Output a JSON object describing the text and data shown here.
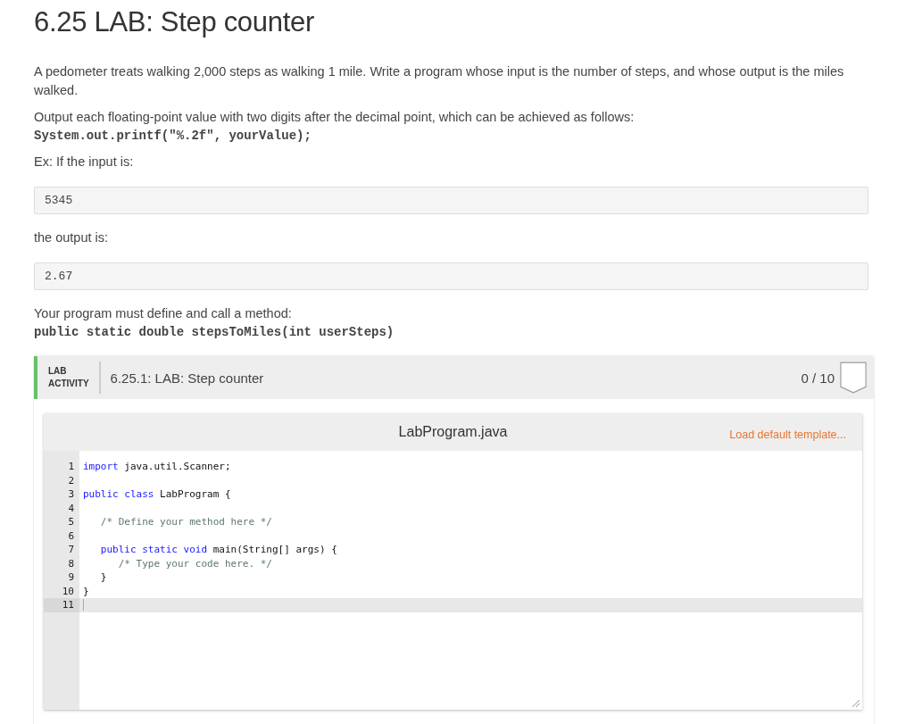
{
  "title": "6.25 LAB: Step counter",
  "paragraphs": [
    {
      "kind": "text",
      "text": "A pedometer treats walking 2,000 steps as walking 1 mile. Write a program whose input is the number of steps, and whose output is the miles walked."
    },
    {
      "kind": "text",
      "text": "Output each floating-point value with two digits after the decimal point, which can be achieved as follows:",
      "code": "System.out.printf(\"%.2f\", yourValue);"
    },
    {
      "kind": "text",
      "text": "Ex: If the input is:"
    },
    {
      "kind": "sample",
      "text": "5345"
    },
    {
      "kind": "text",
      "text": "the output is:"
    },
    {
      "kind": "sample",
      "text": "2.67"
    },
    {
      "kind": "text",
      "text": "Your program must define and call a method:",
      "code": "public static double stepsToMiles(int userSteps)"
    }
  ],
  "lab": {
    "label_lines": [
      "LAB",
      "ACTIVITY"
    ],
    "title": "6.25.1: LAB: Step counter",
    "score": "0 / 10",
    "completed": false,
    "editor": {
      "filename": "LabProgram.java",
      "template_link": "Load default template...",
      "lines": [
        {
          "number": "1",
          "active": false,
          "tokens": [
            {
              "kind": "keyword",
              "text": "import"
            },
            {
              "kind": "plain",
              "text": " java.util.Scanner;"
            }
          ]
        },
        {
          "number": "2",
          "active": false
        },
        {
          "number": "3",
          "active": false,
          "tokens": [
            {
              "kind": "keyword",
              "text": "public class"
            },
            {
              "kind": "plain",
              "text": " LabProgram {"
            }
          ]
        },
        {
          "number": "4",
          "active": false
        },
        {
          "number": "5",
          "active": false,
          "tokens": [
            {
              "kind": "comment",
              "text": "   /* Define your method here */"
            }
          ]
        },
        {
          "number": "6",
          "active": false
        },
        {
          "number": "7",
          "active": false,
          "tokens": [
            {
              "kind": "keyword",
              "text": "   public static void"
            },
            {
              "kind": "plain",
              "text": " main(String[] args) {"
            }
          ]
        },
        {
          "number": "8",
          "active": false,
          "tokens": [
            {
              "kind": "comment",
              "text": "      /* Type your code here. */"
            }
          ]
        },
        {
          "number": "9",
          "active": false,
          "tokens": [
            {
              "kind": "plain",
              "text": "   }"
            }
          ]
        },
        {
          "number": "10",
          "active": false,
          "tokens": [
            {
              "kind": "plain",
              "text": "}"
            }
          ]
        },
        {
          "number": "11",
          "active": true
        }
      ]
    }
  }
}
